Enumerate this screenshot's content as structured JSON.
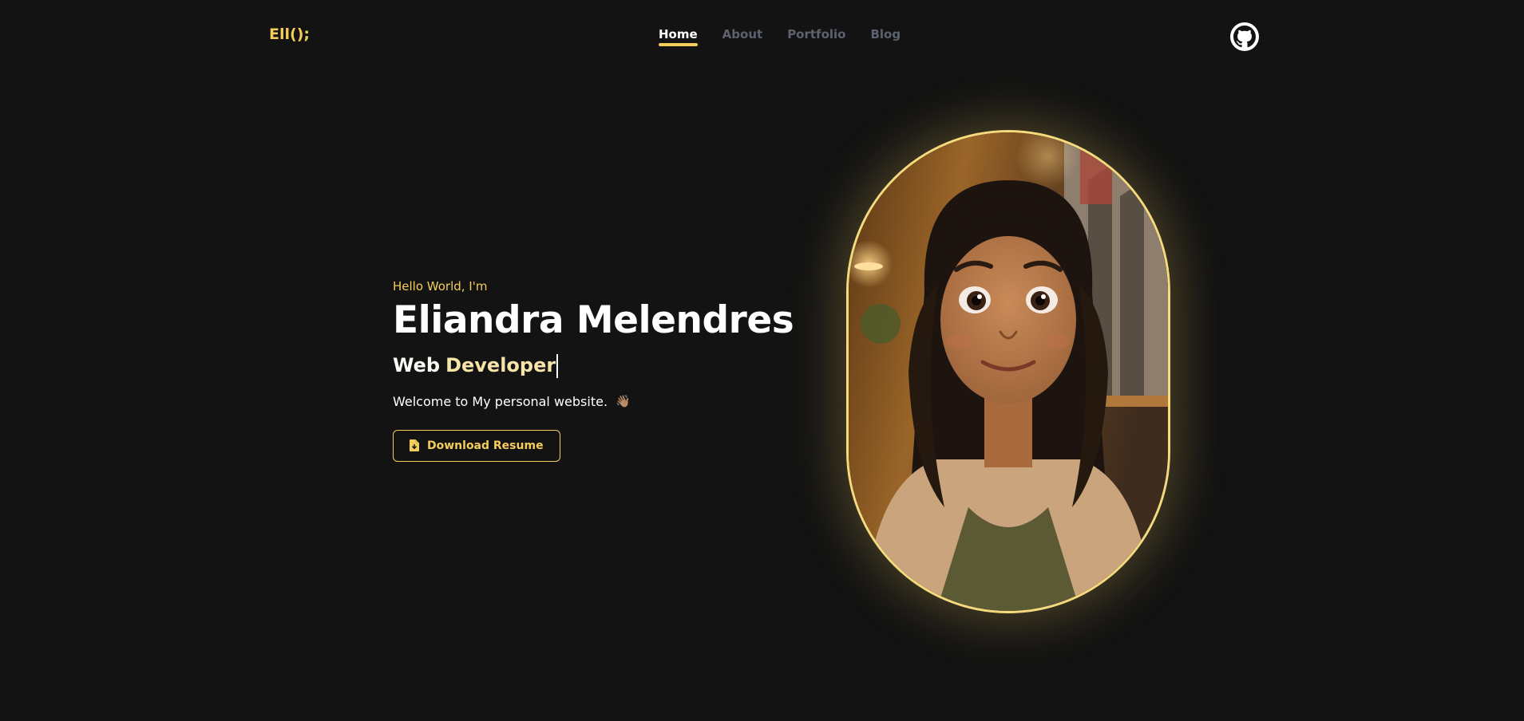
{
  "header": {
    "logo": "Ell();",
    "nav": [
      {
        "label": "Home",
        "active": true
      },
      {
        "label": "About",
        "active": false
      },
      {
        "label": "Portfolio",
        "active": false
      },
      {
        "label": "Blog",
        "active": false
      }
    ],
    "github_icon": "github-icon"
  },
  "hero": {
    "greeting": "Hello World, I'm",
    "name": "Eliandra Melendres",
    "role_prefix": "Web",
    "role_word": "Developer",
    "welcome": "Welcome to My personal website.",
    "wave_icon": "👋🏽",
    "resume_button": "Download Resume",
    "resume_icon": "file-download-icon"
  },
  "portrait": {
    "icon": "portrait-illustration"
  },
  "colors": {
    "accent": "#f4cd5b",
    "background": "#131313",
    "nav_inactive": "#5d6270"
  }
}
